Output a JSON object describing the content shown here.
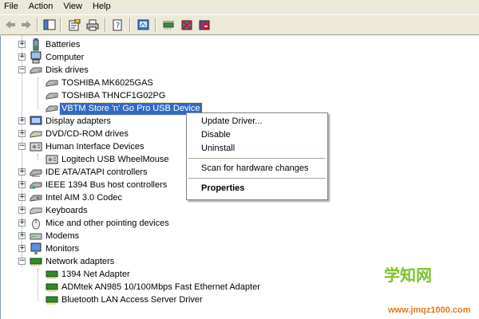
{
  "menubar": {
    "items": [
      "File",
      "Action",
      "View",
      "Help"
    ]
  },
  "toolbar": {
    "icons": [
      "back-icon",
      "forward-icon",
      "show-hide-console-tree-icon",
      "properties-icon",
      "print-icon",
      "help-icon",
      "scan-hardware-icon",
      "update-driver-icon",
      "uninstall-icon",
      "disable-icon"
    ]
  },
  "tree": {
    "items": [
      {
        "label": "Batteries",
        "icon": "battery-icon",
        "expander": "+"
      },
      {
        "label": "Computer",
        "icon": "computer-icon",
        "expander": "+"
      },
      {
        "label": "Disk drives",
        "icon": "disk-drive-icon",
        "expander": "−"
      },
      {
        "label": "TOSHIBA MK6025GAS",
        "icon": "disk-drive-icon"
      },
      {
        "label": "TOSHIBA THNCF1G02PG",
        "icon": "disk-drive-icon"
      },
      {
        "label": "VBTM Store 'n' Go Pro USB Device",
        "icon": "disk-drive-icon",
        "selected": true
      },
      {
        "label": "Display adapters",
        "icon": "display-adapter-icon",
        "expander": "+"
      },
      {
        "label": "DVD/CD-ROM drives",
        "icon": "cd-drive-icon",
        "expander": "+"
      },
      {
        "label": "Human Interface Devices",
        "icon": "hid-icon",
        "expander": "−"
      },
      {
        "label": "Logitech USB WheelMouse",
        "icon": "hid-icon"
      },
      {
        "label": "IDE ATA/ATAPI controllers",
        "icon": "ide-controller-icon",
        "expander": "+"
      },
      {
        "label": "IEEE 1394 Bus host controllers",
        "icon": "ieee1394-icon",
        "expander": "+"
      },
      {
        "label": "Intel AIM 3.0 Codec",
        "icon": "codec-icon",
        "expander": "+"
      },
      {
        "label": "Keyboards",
        "icon": "keyboard-icon",
        "expander": "+"
      },
      {
        "label": "Mice and other pointing devices",
        "icon": "mouse-icon",
        "expander": "+"
      },
      {
        "label": "Modems",
        "icon": "modem-icon",
        "expander": "+"
      },
      {
        "label": "Monitors",
        "icon": "monitor-icon",
        "expander": "+"
      },
      {
        "label": "Network adapters",
        "icon": "network-adapter-icon",
        "expander": "−"
      },
      {
        "label": "1394 Net Adapter",
        "icon": "network-adapter-icon"
      },
      {
        "label": "ADMtek AN985 10/100Mbps Fast Ethernet Adapter",
        "icon": "network-adapter-icon"
      },
      {
        "label": "Bluetooth LAN Access Server Driver",
        "icon": "network-adapter-icon"
      }
    ]
  },
  "context_menu": {
    "update_driver": "Update Driver...",
    "disable": "Disable",
    "uninstall": "Uninstall",
    "scan": "Scan for hardware changes",
    "properties": "Properties"
  },
  "watermark": {
    "title": "学知网",
    "url": "www.jmqz1000.com"
  },
  "colors": {
    "selection": "#316ac5",
    "window": "#ece9d8",
    "watermark_green": "#7bc32a",
    "watermark_orange": "#e07a1a"
  }
}
